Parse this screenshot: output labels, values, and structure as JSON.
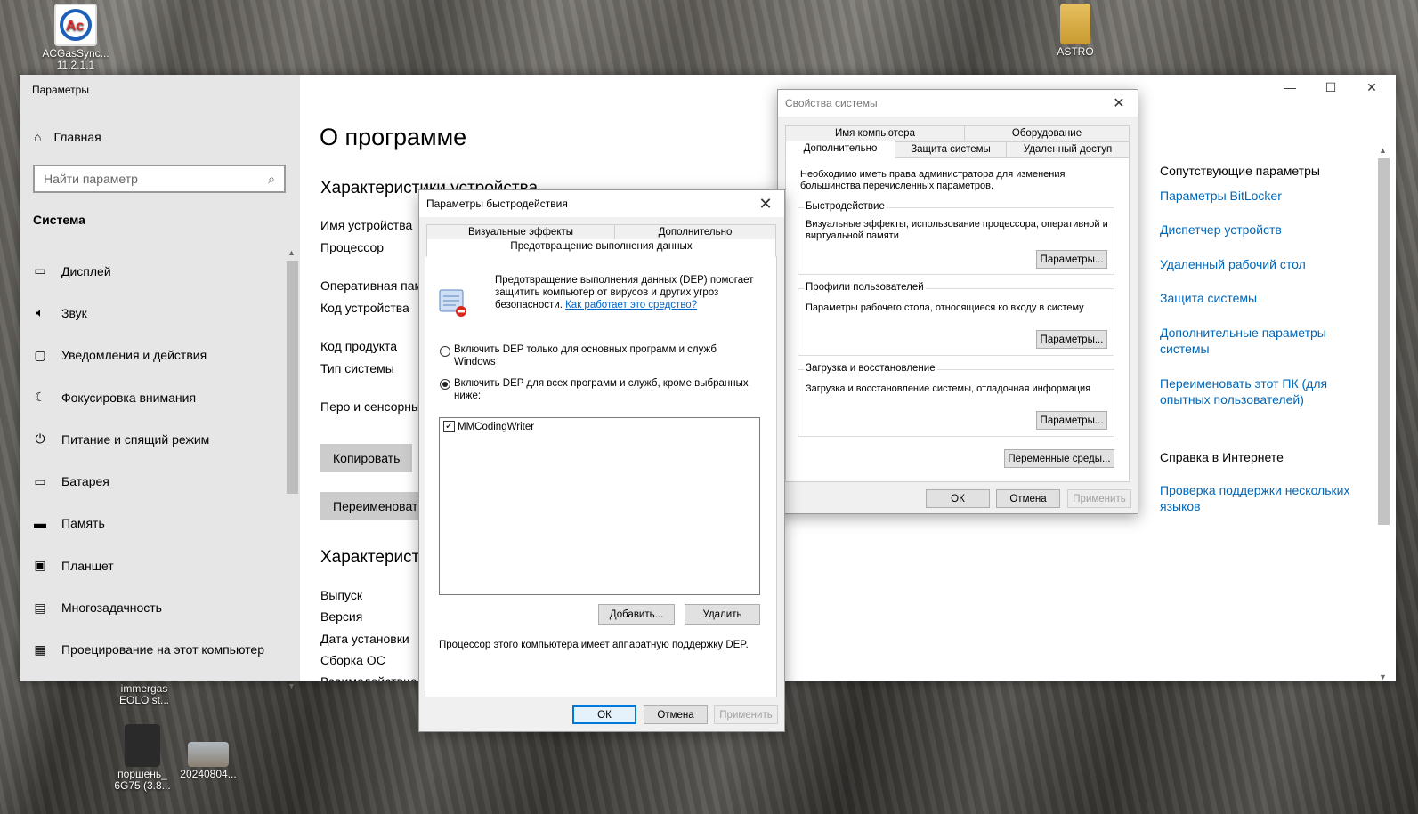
{
  "desktop": {
    "icons": [
      {
        "label": "ACGasSync... 11.2.1.1",
        "color": "#1e5fb8"
      },
      {
        "label": "ASTRO",
        "color": "#d7a640"
      },
      {
        "label": "immergas EOLO st...",
        "color": "#777777"
      },
      {
        "label": "поршень_ 6G75 (3.8...",
        "color": "#555555"
      },
      {
        "label": "20240804...",
        "color": "#8f8a7d"
      }
    ]
  },
  "settings": {
    "app_title": "Параметры",
    "home_label": "Главная",
    "search_placeholder": "Найти параметр",
    "section_title": "Система",
    "nav": [
      {
        "icon": "display-icon",
        "glyph": "▭",
        "label": "Дисплей"
      },
      {
        "icon": "sound-icon",
        "glyph": "🔈",
        "label": "Звук"
      },
      {
        "icon": "notifications-icon",
        "glyph": "▢",
        "label": "Уведомления и действия"
      },
      {
        "icon": "focus-assist-icon",
        "glyph": "☾",
        "label": "Фокусировка внимания"
      },
      {
        "icon": "power-icon",
        "glyph": "⏻",
        "label": "Питание и спящий режим"
      },
      {
        "icon": "battery-icon",
        "glyph": "▭",
        "label": "Батарея"
      },
      {
        "icon": "storage-icon",
        "glyph": "▬",
        "label": "Память"
      },
      {
        "icon": "tablet-icon",
        "glyph": "▣",
        "label": "Планшет"
      },
      {
        "icon": "multitasking-icon",
        "glyph": "▤",
        "label": "Многозадачность"
      },
      {
        "icon": "projecting-icon",
        "glyph": "▦",
        "label": "Проецирование на этот компьютер"
      }
    ],
    "page_title": "О программе",
    "device_specs_title": "Характеристики устройства",
    "device_labels": [
      "Имя устройства",
      "Процессор",
      "Оперативная пам",
      "Код устройства",
      "Код продукта",
      "Тип системы",
      "Перо и сенсорны"
    ],
    "copy_button": "Копировать",
    "rename_button": "Переименовать",
    "windows_specs_title": "Характеристики",
    "windows_labels": [
      "Выпуск",
      "Версия",
      "Дата установки",
      "Сборка ОС",
      "Взаимодействие"
    ],
    "window_controls": {
      "minimize": "—",
      "maximize": "☐",
      "close": "✕"
    },
    "related_title": "Сопутствующие параметры",
    "related_links": [
      "Параметры BitLocker",
      "Диспетчер устройств",
      "Удаленный рабочий стол",
      "Защита системы",
      "Дополнительные параметры системы",
      "Переименовать этот ПК (для опытных пользователей)"
    ],
    "help_title": "Справка в Интернете",
    "help_links": [
      "Проверка поддержки нескольких языков"
    ]
  },
  "system_properties": {
    "title": "Свойства системы",
    "tabs_top": [
      "Имя компьютера",
      "Оборудование"
    ],
    "tabs_bottom": [
      "Дополнительно",
      "Защита системы",
      "Удаленный доступ"
    ],
    "admin_note": "Необходимо иметь права администратора для изменения большинства перечисленных параметров.",
    "groups": [
      {
        "title": "Быстродействие",
        "text": "Визуальные эффекты, использование процессора, оперативной и виртуальной памяти",
        "button": "Параметры..."
      },
      {
        "title": "Профили пользователей",
        "text": "Параметры рабочего стола, относящиеся ко входу в систему",
        "button": "Параметры..."
      },
      {
        "title": "Загрузка и восстановление",
        "text": "Загрузка и восстановление системы, отладочная информация",
        "button": "Параметры..."
      }
    ],
    "env_button": "Переменные среды...",
    "ok": "ОК",
    "cancel": "Отмена",
    "apply": "Применить"
  },
  "performance_options": {
    "title": "Параметры быстродействия",
    "tabs_top": [
      "Визуальные эффекты",
      "Дополнительно"
    ],
    "tab_active": "Предотвращение выполнения данных",
    "dep_description": "Предотвращение выполнения данных (DEP) помогает защитить компьютер от вирусов и других угроз безопасности.",
    "dep_link": "Как работает это средство?",
    "radio_essential": "Включить DEP только для основных программ и служб Windows",
    "radio_all": "Включить DEP для всех программ и служб, кроме выбранных ниже:",
    "radio_selected": "all",
    "list_items": [
      {
        "label": "MMCodingWriter",
        "checked": true
      }
    ],
    "add_button": "Добавить...",
    "remove_button": "Удалить",
    "hw_support": "Процессор этого компьютера имеет аппаратную поддержку DEP.",
    "ok": "ОК",
    "cancel": "Отмена",
    "apply": "Применить"
  }
}
